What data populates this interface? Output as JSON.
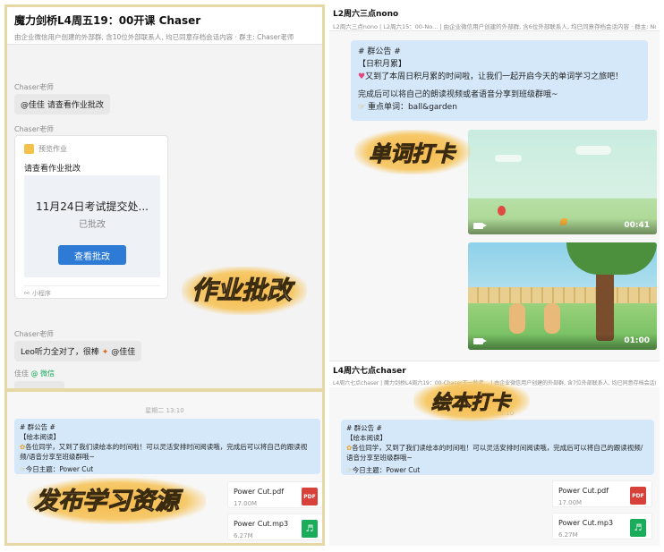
{
  "top_left": {
    "title": "魔力剑桥L4周五19：00开课  Chaser",
    "subtitle": "由企业微信用户创建的外部群, 含10位外部联系人, 均已同意存档会话内容 · 群主: Chaser老师",
    "msg1_sender": "Chaser老师",
    "msg1_text_mention": "@佳佳",
    "msg1_text": " 请查看作业批改",
    "msg2_sender": "Chaser老师",
    "card_app": "预览作业",
    "card_title": "请查看作业批改",
    "card_headline": "11月24日考试提交处...",
    "card_status": "已批改",
    "card_button": "查看批改",
    "card_footer": "小程序",
    "msg3_sender": "Chaser老师",
    "msg3_text": "Leo听力全对了，很棒",
    "msg3_mention": "@佳佳",
    "msg4_sender": "佳佳",
    "msg4_sender_tag": "@ 微信",
    "stamp": "作业批改"
  },
  "top_right": {
    "title": "L2周六三点nono",
    "subtitle": "L2周六三点nono | L2周六15：00-No... | 由企业微信用户创建的外部群, 含6位外部联系人, 均已同意存档会话内容 · 群主: Nono老师",
    "notice_line1": "# 群公告 #",
    "notice_line2": "【日积月累】",
    "notice_line3": "又到了本周日积月累的时间啦，让我们一起开启今天的单词学习之旅吧！",
    "notice_line4": "完成后可以将自己的朗读视频或者语音分享到班级群哦~",
    "notice_line5": "重点单词：ball&garden",
    "video1_time": "00:41",
    "video2_time": "01:00",
    "stamp": "单词打卡",
    "group2_title": "L4周六七点chaser",
    "group2_subtitle": "L4周六七点chaser | 魔力剑桥L4周六19：00-Chaser王一秒老... | 由企业微信用户创建的外部群, 含7位外部联系人, 均已同意存档会话内容 · 群主: Chaser老师"
  },
  "bottom_left": {
    "timestamp": "星期二 13:10",
    "notice_line1": "# 群公告 #",
    "notice_line2": "【绘本阅读】",
    "notice_line3": "各位同学，又到了我们读绘本的时间啦！可以灵活安排时间阅读哦，完成后可以将自己的跟读视频/语音分享至班级群哦~",
    "notice_line4": "今日主题：Power Cut",
    "file1_name": "Power Cut.pdf",
    "file1_size": "17.00M",
    "file1_type": "PDF",
    "file2_name": "Power Cut.mp3",
    "file2_size": "6.27M",
    "file2_type": "♬",
    "stamp": "发布学习资源"
  },
  "bottom_right": {
    "timestamp": "星期二 13:10",
    "notice_line1": "# 群公告 #",
    "notice_line2": "【绘本阅读】",
    "notice_line3": "各位同学，又到了我们读绘本的时间啦！可以灵活安排时间阅读哦，完成后可以将自己的跟读视频/语音分享至班级群哦~",
    "notice_line4": "今日主题：Power Cut",
    "file1_name": "Power Cut.pdf",
    "file1_size": "17.00M",
    "file1_type": "PDF",
    "file2_name": "Power Cut.mp3",
    "file2_size": "6.27M",
    "file2_type": "♬",
    "stamp": "绘本打卡"
  },
  "colors": {
    "accent_blue": "#2e7bd6",
    "notice_bg": "#d4e8fa",
    "pdf_red": "#d8403a",
    "mp3_green": "#1aab5b",
    "stamp_orange": "#f5b84a"
  }
}
